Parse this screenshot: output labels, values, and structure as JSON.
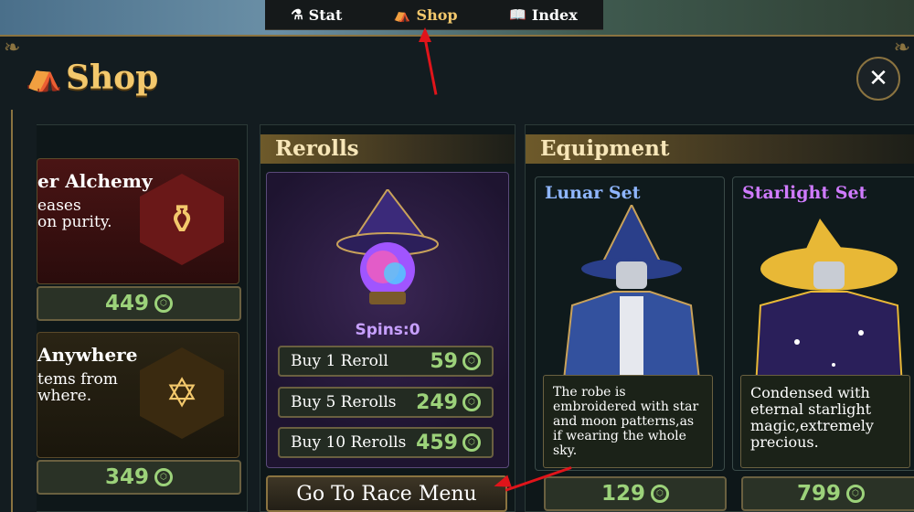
{
  "topnav": {
    "tabs": [
      {
        "label": "Stat",
        "icon": "flask-icon"
      },
      {
        "label": "Shop",
        "icon": "shop-icon",
        "active": true
      },
      {
        "label": "Index",
        "icon": "book-icon"
      }
    ]
  },
  "shop": {
    "title": "Shop",
    "close_symbol": "✕"
  },
  "perks": [
    {
      "title": "er Alchemy",
      "description": "eases\non purity.",
      "price": "449",
      "icon": "cauldron-icon"
    },
    {
      "title": "Anywhere",
      "description": "tems from\nwhere.",
      "price": "349",
      "icon": "hexagram-icon"
    }
  ],
  "rerolls": {
    "header": "Rerolls",
    "spins_label": "Spins:0",
    "buttons": [
      {
        "label": "Buy 1 Reroll",
        "price": "59"
      },
      {
        "label": "Buy 5 Rerolls",
        "price": "249"
      },
      {
        "label": "Buy 10 Rerolls",
        "price": "459"
      }
    ],
    "race_menu_label": "Go To Race Menu"
  },
  "equipment": {
    "header": "Equipment",
    "items": [
      {
        "name": "Lunar Set",
        "name_color": "#8fb6ff",
        "description": "The robe is embroidered with star and moon patterns,as if wearing the whole sky.",
        "price": "129"
      },
      {
        "name": "Starlight Set",
        "name_color": "#d07bff",
        "description": "Condensed with eternal starlight magic,extremely precious.",
        "price": "799"
      }
    ]
  },
  "colors": {
    "accent_gold": "#f3c86c",
    "price_green": "#9cd27a",
    "annotation_red": "#e0141a"
  }
}
